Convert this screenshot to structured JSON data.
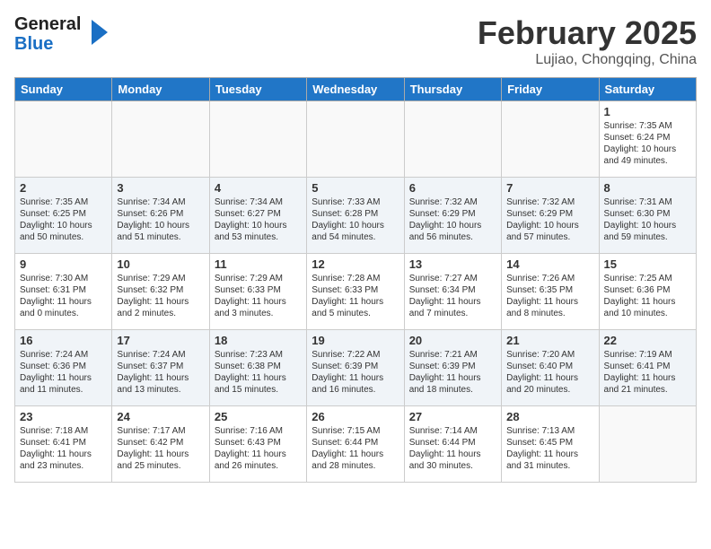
{
  "header": {
    "logo_line1": "General",
    "logo_line2": "Blue",
    "month_title": "February 2025",
    "location": "Lujiao, Chongqing, China"
  },
  "calendar": {
    "days_of_week": [
      "Sunday",
      "Monday",
      "Tuesday",
      "Wednesday",
      "Thursday",
      "Friday",
      "Saturday"
    ],
    "weeks": [
      [
        {
          "day": "",
          "info": ""
        },
        {
          "day": "",
          "info": ""
        },
        {
          "day": "",
          "info": ""
        },
        {
          "day": "",
          "info": ""
        },
        {
          "day": "",
          "info": ""
        },
        {
          "day": "",
          "info": ""
        },
        {
          "day": "1",
          "info": "Sunrise: 7:35 AM\nSunset: 6:24 PM\nDaylight: 10 hours and 49 minutes."
        }
      ],
      [
        {
          "day": "2",
          "info": "Sunrise: 7:35 AM\nSunset: 6:25 PM\nDaylight: 10 hours and 50 minutes."
        },
        {
          "day": "3",
          "info": "Sunrise: 7:34 AM\nSunset: 6:26 PM\nDaylight: 10 hours and 51 minutes."
        },
        {
          "day": "4",
          "info": "Sunrise: 7:34 AM\nSunset: 6:27 PM\nDaylight: 10 hours and 53 minutes."
        },
        {
          "day": "5",
          "info": "Sunrise: 7:33 AM\nSunset: 6:28 PM\nDaylight: 10 hours and 54 minutes."
        },
        {
          "day": "6",
          "info": "Sunrise: 7:32 AM\nSunset: 6:29 PM\nDaylight: 10 hours and 56 minutes."
        },
        {
          "day": "7",
          "info": "Sunrise: 7:32 AM\nSunset: 6:29 PM\nDaylight: 10 hours and 57 minutes."
        },
        {
          "day": "8",
          "info": "Sunrise: 7:31 AM\nSunset: 6:30 PM\nDaylight: 10 hours and 59 minutes."
        }
      ],
      [
        {
          "day": "9",
          "info": "Sunrise: 7:30 AM\nSunset: 6:31 PM\nDaylight: 11 hours and 0 minutes."
        },
        {
          "day": "10",
          "info": "Sunrise: 7:29 AM\nSunset: 6:32 PM\nDaylight: 11 hours and 2 minutes."
        },
        {
          "day": "11",
          "info": "Sunrise: 7:29 AM\nSunset: 6:33 PM\nDaylight: 11 hours and 3 minutes."
        },
        {
          "day": "12",
          "info": "Sunrise: 7:28 AM\nSunset: 6:33 PM\nDaylight: 11 hours and 5 minutes."
        },
        {
          "day": "13",
          "info": "Sunrise: 7:27 AM\nSunset: 6:34 PM\nDaylight: 11 hours and 7 minutes."
        },
        {
          "day": "14",
          "info": "Sunrise: 7:26 AM\nSunset: 6:35 PM\nDaylight: 11 hours and 8 minutes."
        },
        {
          "day": "15",
          "info": "Sunrise: 7:25 AM\nSunset: 6:36 PM\nDaylight: 11 hours and 10 minutes."
        }
      ],
      [
        {
          "day": "16",
          "info": "Sunrise: 7:24 AM\nSunset: 6:36 PM\nDaylight: 11 hours and 11 minutes."
        },
        {
          "day": "17",
          "info": "Sunrise: 7:24 AM\nSunset: 6:37 PM\nDaylight: 11 hours and 13 minutes."
        },
        {
          "day": "18",
          "info": "Sunrise: 7:23 AM\nSunset: 6:38 PM\nDaylight: 11 hours and 15 minutes."
        },
        {
          "day": "19",
          "info": "Sunrise: 7:22 AM\nSunset: 6:39 PM\nDaylight: 11 hours and 16 minutes."
        },
        {
          "day": "20",
          "info": "Sunrise: 7:21 AM\nSunset: 6:39 PM\nDaylight: 11 hours and 18 minutes."
        },
        {
          "day": "21",
          "info": "Sunrise: 7:20 AM\nSunset: 6:40 PM\nDaylight: 11 hours and 20 minutes."
        },
        {
          "day": "22",
          "info": "Sunrise: 7:19 AM\nSunset: 6:41 PM\nDaylight: 11 hours and 21 minutes."
        }
      ],
      [
        {
          "day": "23",
          "info": "Sunrise: 7:18 AM\nSunset: 6:41 PM\nDaylight: 11 hours and 23 minutes."
        },
        {
          "day": "24",
          "info": "Sunrise: 7:17 AM\nSunset: 6:42 PM\nDaylight: 11 hours and 25 minutes."
        },
        {
          "day": "25",
          "info": "Sunrise: 7:16 AM\nSunset: 6:43 PM\nDaylight: 11 hours and 26 minutes."
        },
        {
          "day": "26",
          "info": "Sunrise: 7:15 AM\nSunset: 6:44 PM\nDaylight: 11 hours and 28 minutes."
        },
        {
          "day": "27",
          "info": "Sunrise: 7:14 AM\nSunset: 6:44 PM\nDaylight: 11 hours and 30 minutes."
        },
        {
          "day": "28",
          "info": "Sunrise: 7:13 AM\nSunset: 6:45 PM\nDaylight: 11 hours and 31 minutes."
        },
        {
          "day": "",
          "info": ""
        }
      ]
    ]
  }
}
